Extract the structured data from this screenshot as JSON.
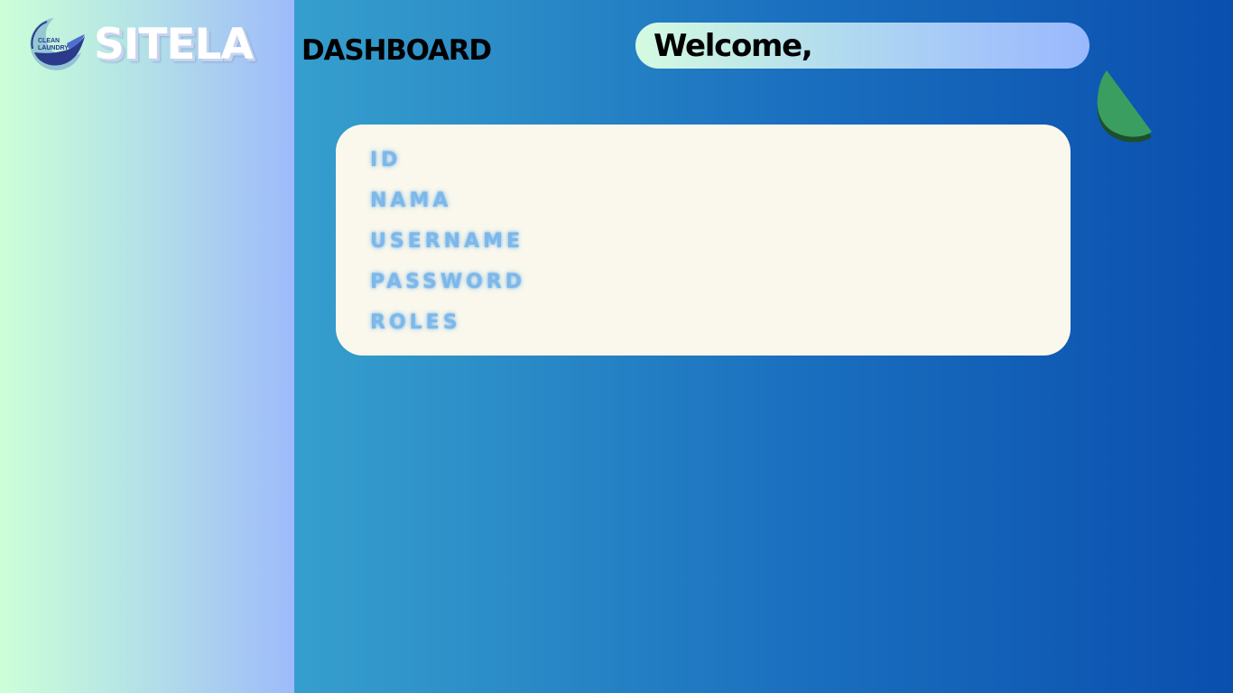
{
  "sidebar": {
    "logo_badge_line1": "CLEAN",
    "logo_badge_line2": "LAUNDRY",
    "brand": "SITELA"
  },
  "header": {
    "title": "DASHBOARD",
    "welcome": "Welcome,"
  },
  "profile_card": {
    "fields": [
      {
        "label": "ID"
      },
      {
        "label": "NAMA"
      },
      {
        "label": "USERNAME"
      },
      {
        "label": "PASSWORD"
      },
      {
        "label": "ROLES"
      }
    ]
  },
  "colors": {
    "sidebar_start": "#ccffd8",
    "sidebar_end": "#9dbbfb",
    "main_start": "#45b8d8",
    "main_end": "#0a4fae",
    "card_bg": "#faf8ec",
    "field_label": "#7db8ea",
    "deco_green": "#3a9e60"
  },
  "icons": {
    "logo": "clean-laundry-logo-icon",
    "decoration": "leaf-shape-icon"
  }
}
